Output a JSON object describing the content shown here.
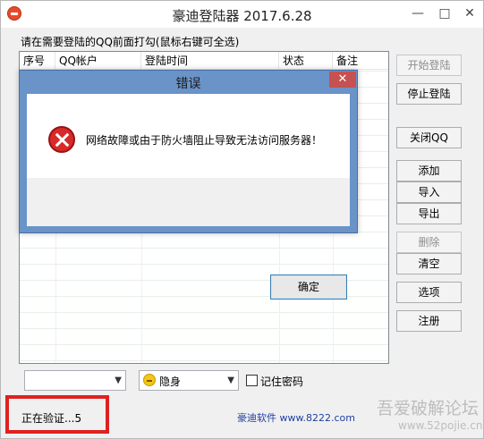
{
  "window": {
    "title": "豪迪登陆器 2017.6.28",
    "controls": {
      "minimize": "—",
      "maximize": "□",
      "close": "✕"
    }
  },
  "hint": "请在需要登陆的QQ前面打勾(鼠标右键可全选)",
  "list": {
    "columns": [
      "序号",
      "QQ帐户",
      "登陆时间",
      "状态",
      "备注"
    ]
  },
  "buttons": {
    "start_login": "开始登陆",
    "stop_login": "停止登陆",
    "close_qq": "关闭QQ",
    "add": "添加",
    "import": "导入",
    "export": "导出",
    "delete": "删除",
    "clear": "清空",
    "options": "选项",
    "register": "注册"
  },
  "account_combo": {
    "value": ""
  },
  "status_combo": {
    "value": "隐身"
  },
  "remember_password": {
    "label": "记住密码",
    "checked": false
  },
  "status_text": "正在验证...5",
  "footer_link": "豪迪软件 www.8222.com",
  "watermark": {
    "line1": "吾爱破解论坛",
    "line2": "www.52pojie.cn"
  },
  "dialog": {
    "title": "错误",
    "close": "✕",
    "message": "网络故障或由于防火墙阻止导致无法访问服务器！",
    "ok": "确定"
  },
  "colors": {
    "dialog_frame": "#6a93c8",
    "error_red": "#d72a2a",
    "highlight_box": "#e02020",
    "link": "#1f3fa0"
  }
}
